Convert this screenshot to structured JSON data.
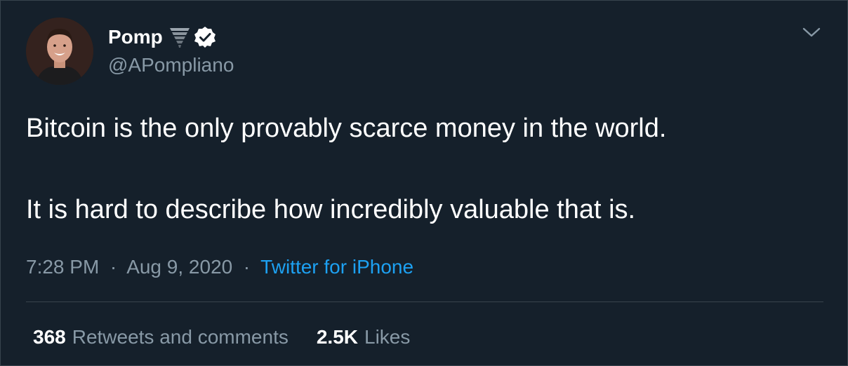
{
  "author": {
    "name": "Pomp",
    "handle": "@APompliano",
    "verified": true,
    "name_emoji": "tornado-icon"
  },
  "tweet": {
    "line1": "Bitcoin is the only provably scarce money in the world.",
    "line2": "It is hard to describe how incredibly valuable that is."
  },
  "meta": {
    "time": "7:28 PM",
    "separator": "·",
    "date": "Aug 9, 2020",
    "source": "Twitter for iPhone"
  },
  "stats": {
    "retweets_count": "368",
    "retweets_label": "Retweets and comments",
    "likes_count": "2.5K",
    "likes_label": "Likes"
  },
  "colors": {
    "background": "#15202b",
    "text_primary": "#ffffff",
    "text_secondary": "#8899a6",
    "accent": "#1da1f2",
    "border": "#38444d"
  }
}
